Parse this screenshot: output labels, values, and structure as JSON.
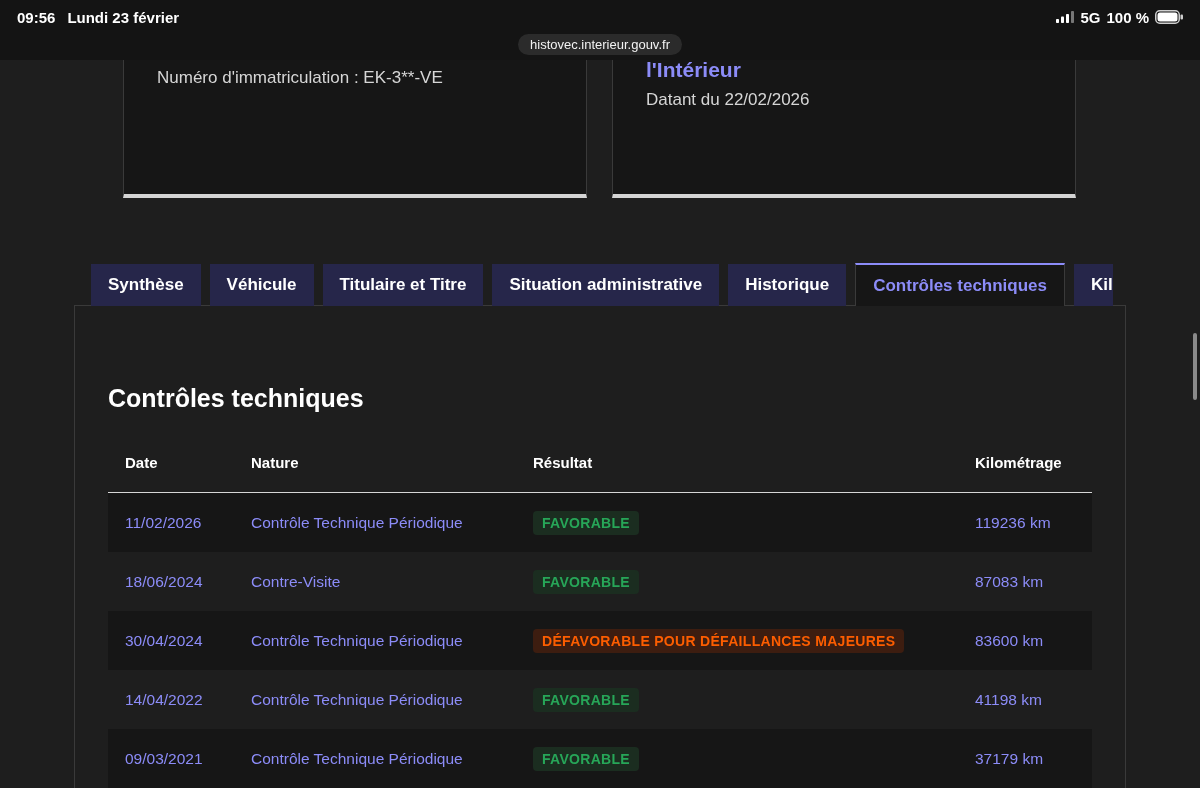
{
  "status_bar": {
    "time": "09:56",
    "date": "Lundi 23 février",
    "network": "5G",
    "battery": "100 %"
  },
  "url_bar": {
    "address": "histovec.interieur.gouv.fr"
  },
  "cards": [
    {
      "lines": [
        {
          "kind": "text",
          "text": "Numéro d'immatriculation : EK-3**-VE"
        }
      ]
    },
    {
      "lines": [
        {
          "kind": "source",
          "text": "l'Intérieur"
        },
        {
          "kind": "text",
          "text": "Datant du 22/02/2026"
        }
      ]
    }
  ],
  "tabs": [
    {
      "label": "Synthèse",
      "selected": false
    },
    {
      "label": "Véhicule",
      "selected": false
    },
    {
      "label": "Titulaire et Titre",
      "selected": false
    },
    {
      "label": "Situation administrative",
      "selected": false
    },
    {
      "label": "Historique",
      "selected": false
    },
    {
      "label": "Contrôles techniques",
      "selected": true
    },
    {
      "label": "Kil",
      "selected": false
    }
  ],
  "section": {
    "title": "Contrôles techniques",
    "table": {
      "columns": [
        "Date",
        "Nature",
        "Résultat",
        "Kilométrage"
      ],
      "rows": [
        {
          "date": "11/02/2026",
          "nature": "Contrôle Technique Périodique",
          "result": {
            "text": "FAVORABLE",
            "kind": "success"
          },
          "mileage": "119236 km"
        },
        {
          "date": "18/06/2024",
          "nature": "Contre-Visite",
          "result": {
            "text": "FAVORABLE",
            "kind": "success"
          },
          "mileage": "87083 km"
        },
        {
          "date": "30/04/2024",
          "nature": "Contrôle Technique Périodique",
          "result": {
            "text": "DÉFAVORABLE POUR DÉFAILLANCES MAJEURES",
            "kind": "error"
          },
          "mileage": "83600 km"
        },
        {
          "date": "14/04/2022",
          "nature": "Contrôle Technique Périodique",
          "result": {
            "text": "FAVORABLE",
            "kind": "success"
          },
          "mileage": "41198 km"
        },
        {
          "date": "09/03/2021",
          "nature": "Contrôle Technique Périodique",
          "result": {
            "text": "FAVORABLE",
            "kind": "success"
          },
          "mileage": "37179 km"
        }
      ]
    }
  }
}
